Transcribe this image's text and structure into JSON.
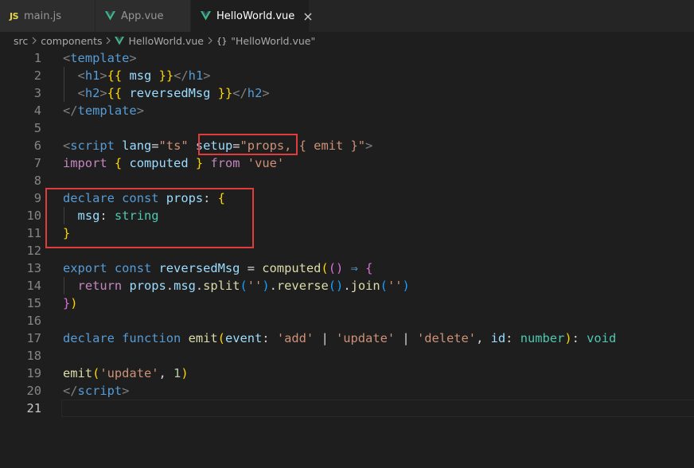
{
  "tabs": [
    {
      "icon": "js-file-icon",
      "icon_text": "JS",
      "label": "main.js",
      "active": false
    },
    {
      "icon": "vue-file-icon",
      "label": "App.vue",
      "active": false
    },
    {
      "icon": "vue-file-icon",
      "label": "HelloWorld.vue",
      "active": true,
      "close": "×"
    }
  ],
  "breadcrumb": {
    "items": [
      "src",
      "components",
      "HelloWorld.vue"
    ],
    "symbol": "{}",
    "symbol_label": "\"HelloWorld.vue\""
  },
  "editor": {
    "current_line": 21,
    "lines": [
      [
        {
          "c": "t-punc",
          "t": "<"
        },
        {
          "c": "t-tag",
          "t": "template"
        },
        {
          "c": "t-punc",
          "t": ">"
        }
      ],
      [
        {
          "c": "t-plain",
          "t": "  "
        },
        {
          "c": "t-punc",
          "t": "<"
        },
        {
          "c": "t-tag",
          "t": "h1"
        },
        {
          "c": "t-punc",
          "t": ">"
        },
        {
          "c": "t-brace",
          "t": "{{"
        },
        {
          "c": "t-plain",
          "t": " "
        },
        {
          "c": "t-var",
          "t": "msg"
        },
        {
          "c": "t-plain",
          "t": " "
        },
        {
          "c": "t-brace",
          "t": "}}"
        },
        {
          "c": "t-punc",
          "t": "</"
        },
        {
          "c": "t-tag",
          "t": "h1"
        },
        {
          "c": "t-punc",
          "t": ">"
        }
      ],
      [
        {
          "c": "t-plain",
          "t": "  "
        },
        {
          "c": "t-punc",
          "t": "<"
        },
        {
          "c": "t-tag",
          "t": "h2"
        },
        {
          "c": "t-punc",
          "t": ">"
        },
        {
          "c": "t-brace",
          "t": "{{"
        },
        {
          "c": "t-plain",
          "t": " "
        },
        {
          "c": "t-var",
          "t": "reversedMsg"
        },
        {
          "c": "t-plain",
          "t": " "
        },
        {
          "c": "t-brace",
          "t": "}}"
        },
        {
          "c": "t-punc",
          "t": "</"
        },
        {
          "c": "t-tag",
          "t": "h2"
        },
        {
          "c": "t-punc",
          "t": ">"
        }
      ],
      [
        {
          "c": "t-punc",
          "t": "</"
        },
        {
          "c": "t-tag",
          "t": "template"
        },
        {
          "c": "t-punc",
          "t": ">"
        }
      ],
      [],
      [
        {
          "c": "t-punc",
          "t": "<"
        },
        {
          "c": "t-tag",
          "t": "script"
        },
        {
          "c": "t-plain",
          "t": " "
        },
        {
          "c": "t-attr",
          "t": "lang"
        },
        {
          "c": "t-plain",
          "t": "="
        },
        {
          "c": "t-str",
          "t": "\"ts\""
        },
        {
          "c": "t-plain",
          "t": " "
        },
        {
          "c": "t-attr",
          "t": "setup"
        },
        {
          "c": "t-plain",
          "t": "="
        },
        {
          "c": "t-str",
          "t": "\"props, { emit }\""
        },
        {
          "c": "t-punc",
          "t": ">"
        }
      ],
      [
        {
          "c": "t-kw2",
          "t": "import"
        },
        {
          "c": "t-plain",
          "t": " "
        },
        {
          "c": "t-brace",
          "t": "{"
        },
        {
          "c": "t-plain",
          "t": " "
        },
        {
          "c": "t-var",
          "t": "computed"
        },
        {
          "c": "t-plain",
          "t": " "
        },
        {
          "c": "t-brace",
          "t": "}"
        },
        {
          "c": "t-plain",
          "t": " "
        },
        {
          "c": "t-kw2",
          "t": "from"
        },
        {
          "c": "t-plain",
          "t": " "
        },
        {
          "c": "t-str",
          "t": "'vue'"
        }
      ],
      [],
      [
        {
          "c": "t-kw",
          "t": "declare"
        },
        {
          "c": "t-plain",
          "t": " "
        },
        {
          "c": "t-kw",
          "t": "const"
        },
        {
          "c": "t-plain",
          "t": " "
        },
        {
          "c": "t-var",
          "t": "props"
        },
        {
          "c": "t-plain",
          "t": ": "
        },
        {
          "c": "t-brace",
          "t": "{"
        }
      ],
      [
        {
          "c": "t-plain",
          "t": "  "
        },
        {
          "c": "t-var",
          "t": "msg"
        },
        {
          "c": "t-plain",
          "t": ": "
        },
        {
          "c": "t-type",
          "t": "string"
        }
      ],
      [
        {
          "c": "t-brace",
          "t": "}"
        }
      ],
      [],
      [
        {
          "c": "t-kw",
          "t": "export"
        },
        {
          "c": "t-plain",
          "t": " "
        },
        {
          "c": "t-kw",
          "t": "const"
        },
        {
          "c": "t-plain",
          "t": " "
        },
        {
          "c": "t-var",
          "t": "reversedMsg"
        },
        {
          "c": "t-plain",
          "t": " = "
        },
        {
          "c": "t-fn",
          "t": "computed"
        },
        {
          "c": "t-brace",
          "t": "("
        },
        {
          "c": "t-brace2",
          "t": "()"
        },
        {
          "c": "t-plain",
          "t": " "
        },
        {
          "c": "t-arrow",
          "t": "⇒"
        },
        {
          "c": "t-plain",
          "t": " "
        },
        {
          "c": "t-brace2",
          "t": "{"
        }
      ],
      [
        {
          "c": "t-plain",
          "t": "  "
        },
        {
          "c": "t-kw2",
          "t": "return"
        },
        {
          "c": "t-plain",
          "t": " "
        },
        {
          "c": "t-var",
          "t": "props"
        },
        {
          "c": "t-plain",
          "t": "."
        },
        {
          "c": "t-var",
          "t": "msg"
        },
        {
          "c": "t-plain",
          "t": "."
        },
        {
          "c": "t-fn",
          "t": "split"
        },
        {
          "c": "t-brace3",
          "t": "("
        },
        {
          "c": "t-str",
          "t": "''"
        },
        {
          "c": "t-brace3",
          "t": ")"
        },
        {
          "c": "t-plain",
          "t": "."
        },
        {
          "c": "t-fn",
          "t": "reverse"
        },
        {
          "c": "t-brace3",
          "t": "()"
        },
        {
          "c": "t-plain",
          "t": "."
        },
        {
          "c": "t-fn",
          "t": "join"
        },
        {
          "c": "t-brace3",
          "t": "("
        },
        {
          "c": "t-str",
          "t": "''"
        },
        {
          "c": "t-brace3",
          "t": ")"
        }
      ],
      [
        {
          "c": "t-brace2",
          "t": "}"
        },
        {
          "c": "t-brace",
          "t": ")"
        }
      ],
      [],
      [
        {
          "c": "t-kw",
          "t": "declare"
        },
        {
          "c": "t-plain",
          "t": " "
        },
        {
          "c": "t-kw",
          "t": "function"
        },
        {
          "c": "t-plain",
          "t": " "
        },
        {
          "c": "t-fn",
          "t": "emit"
        },
        {
          "c": "t-brace",
          "t": "("
        },
        {
          "c": "t-var",
          "t": "event"
        },
        {
          "c": "t-plain",
          "t": ": "
        },
        {
          "c": "t-str",
          "t": "'add'"
        },
        {
          "c": "t-plain",
          "t": " | "
        },
        {
          "c": "t-str",
          "t": "'update'"
        },
        {
          "c": "t-plain",
          "t": " | "
        },
        {
          "c": "t-str",
          "t": "'delete'"
        },
        {
          "c": "t-plain",
          "t": ", "
        },
        {
          "c": "t-var",
          "t": "id"
        },
        {
          "c": "t-plain",
          "t": ": "
        },
        {
          "c": "t-type",
          "t": "number"
        },
        {
          "c": "t-brace",
          "t": ")"
        },
        {
          "c": "t-plain",
          "t": ": "
        },
        {
          "c": "t-type",
          "t": "void"
        }
      ],
      [],
      [
        {
          "c": "t-fn",
          "t": "emit"
        },
        {
          "c": "t-brace",
          "t": "("
        },
        {
          "c": "t-str",
          "t": "'update'"
        },
        {
          "c": "t-plain",
          "t": ", "
        },
        {
          "c": "t-num",
          "t": "1"
        },
        {
          "c": "t-brace",
          "t": ")"
        }
      ],
      [
        {
          "c": "t-punc",
          "t": "</"
        },
        {
          "c": "t-tag",
          "t": "script"
        },
        {
          "c": "t-punc",
          "t": ">"
        }
      ],
      []
    ]
  },
  "colors": {
    "highlight_box": "#e03c3c",
    "vue_icon": "#41b883",
    "js_icon": "#e8d44d"
  }
}
